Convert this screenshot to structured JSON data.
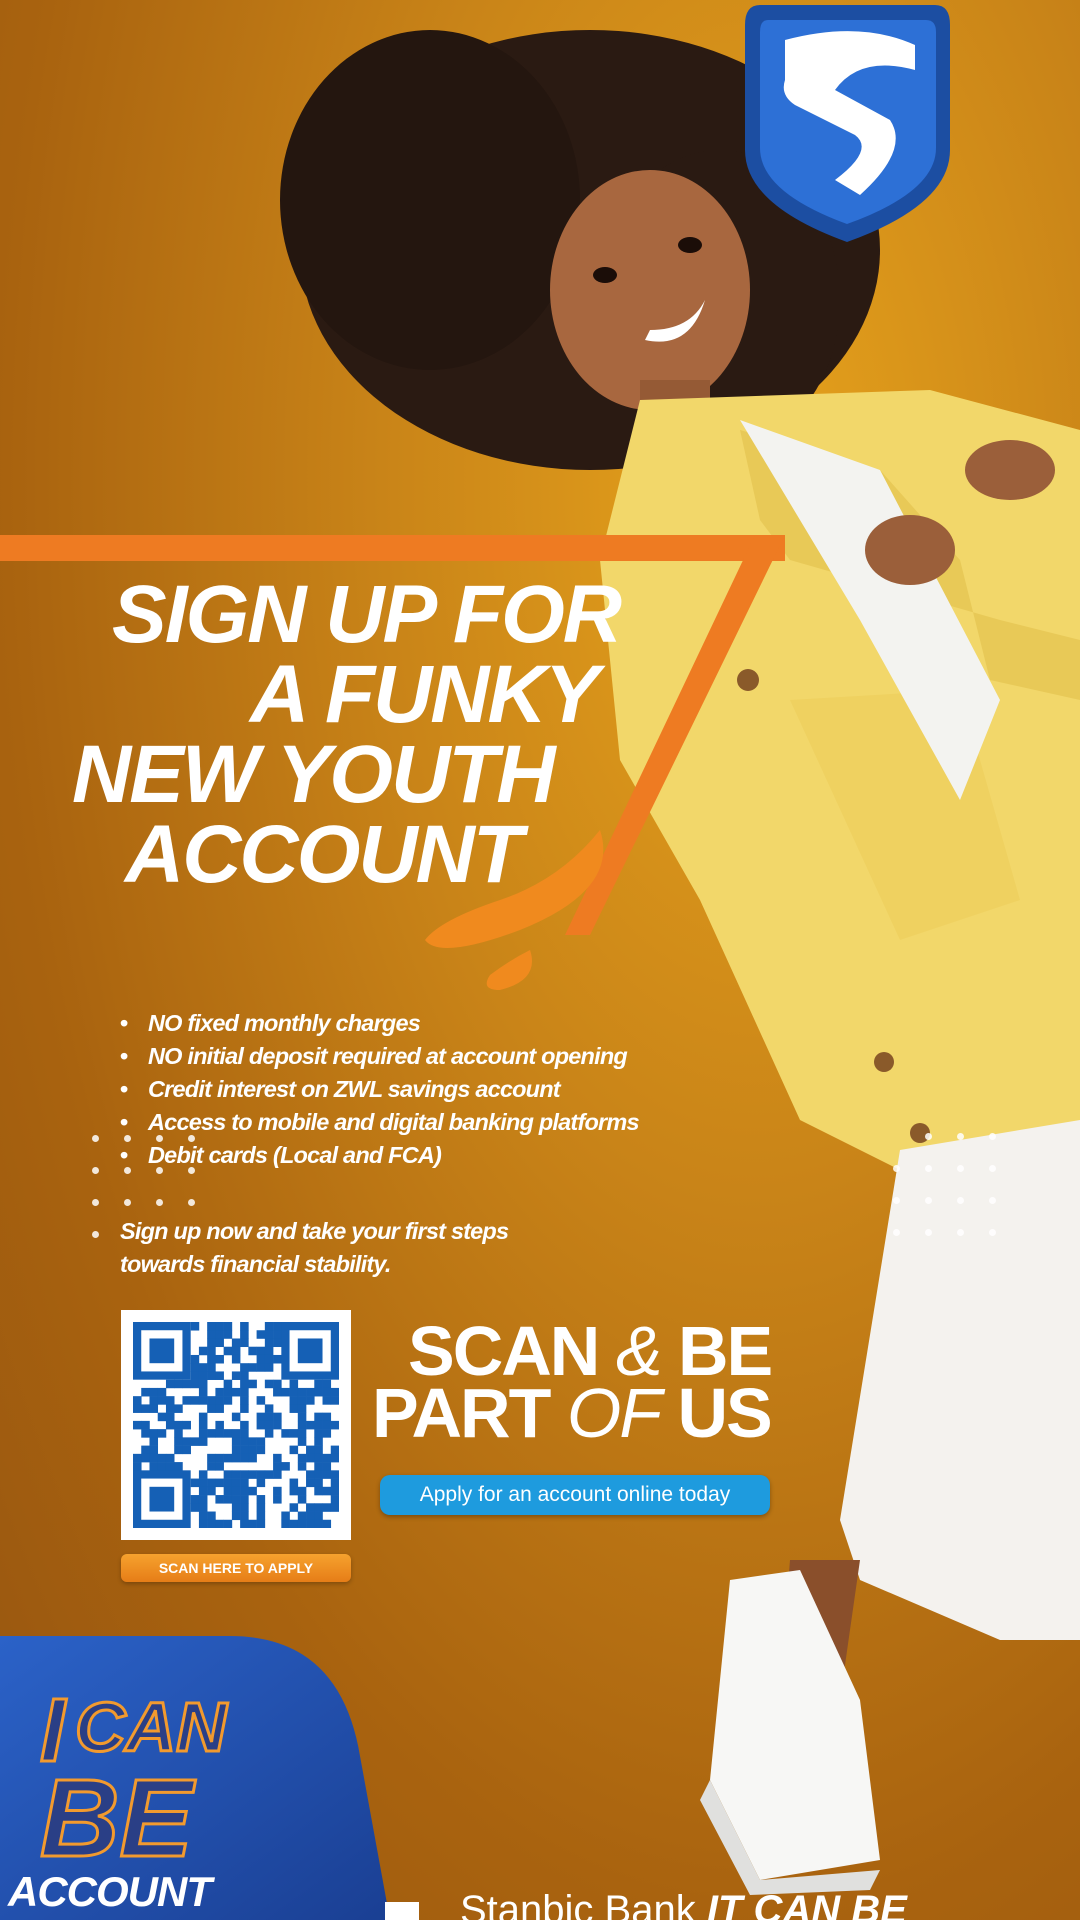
{
  "brand": {
    "logo_icon": "standard-bank-shield-icon",
    "primary": "#1d4fa3",
    "accent": "#f07f1e"
  },
  "headline": [
    "SIGN UP FOR",
    "A FUNKY",
    "NEW YOUTH",
    "ACCOUNT"
  ],
  "benefits": [
    "NO fixed monthly charges",
    "NO initial deposit required at account opening",
    "Credit interest on ZWL savings account",
    "Access to mobile and digital banking platforms",
    "Debit cards (Local and FCA)"
  ],
  "cta_text": [
    "Sign up now and take your first steps",
    "towards financial  stability."
  ],
  "qr": {
    "scan_label": "SCAN HERE TO APPLY"
  },
  "slogan": {
    "line1": {
      "a": "SCAN",
      "b": "&",
      "c": "BE"
    },
    "line2": {
      "a": "PART",
      "b": "OF",
      "c": "US"
    }
  },
  "apply_button": "Apply for an account online today",
  "badge": {
    "title_graphic": "I CAN BE",
    "subtitle": "ACCOUNT"
  },
  "footer": {
    "bank": "Stanbic Bank",
    "tagline": "IT CAN BE"
  }
}
